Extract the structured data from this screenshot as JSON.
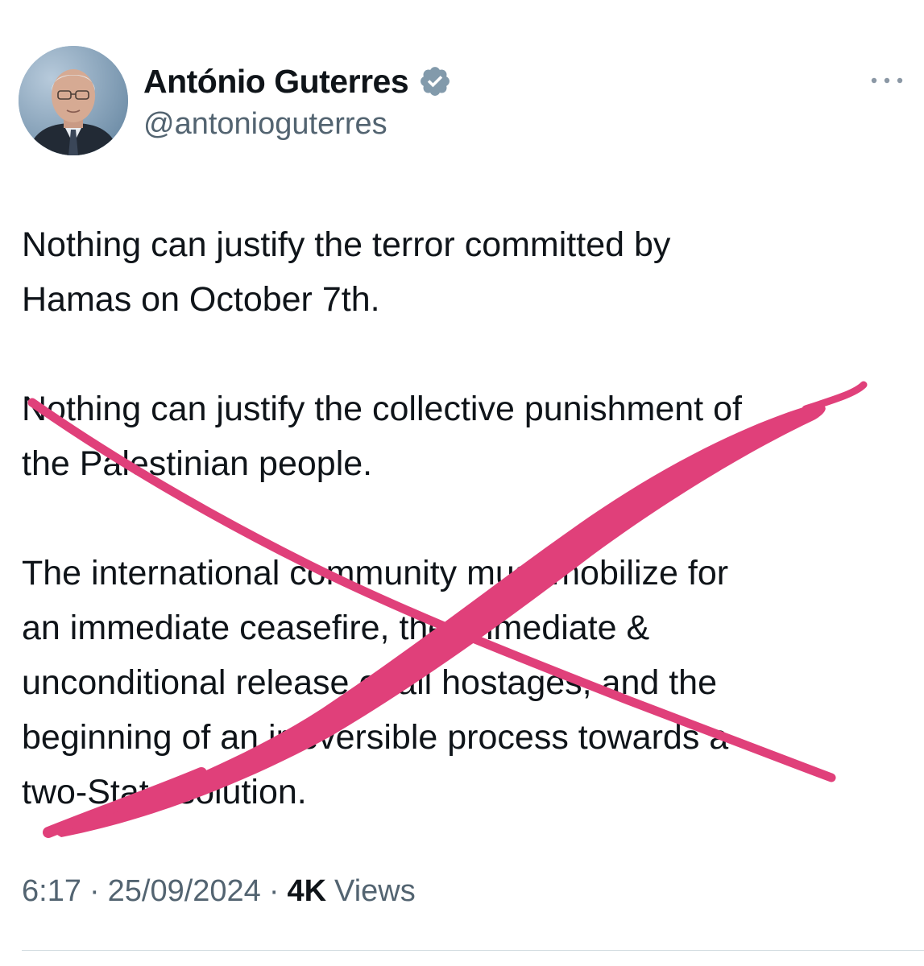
{
  "author": {
    "display_name": "António Guterres",
    "handle": "@antonioguterres",
    "verified": true,
    "avatar": "profile-photo"
  },
  "tweet": {
    "paragraphs": [
      "Nothing can justify the terror committed by\nHamas on October 7th.",
      "Nothing can justify the collective punishment of\nthe Palestinian people.",
      "The international community must mobilize for\nan immediate ceasefire, the immediate &\nunconditional release of all hostages, and the\nbeginning of an irreversible process towards a\ntwo-State solution."
    ],
    "time": "6:17",
    "date": "25/09/2024",
    "views_count": "4K",
    "views_label": "Views",
    "separator": "·"
  },
  "annotation": {
    "type": "hand-drawn-x",
    "color": "#e0407a"
  },
  "colors": {
    "text_primary": "#0f1419",
    "text_secondary": "#536471",
    "verified_badge": "#829aab"
  },
  "icons": {
    "more": "more-horizontal-icon",
    "verified": "verified-badge-icon"
  }
}
